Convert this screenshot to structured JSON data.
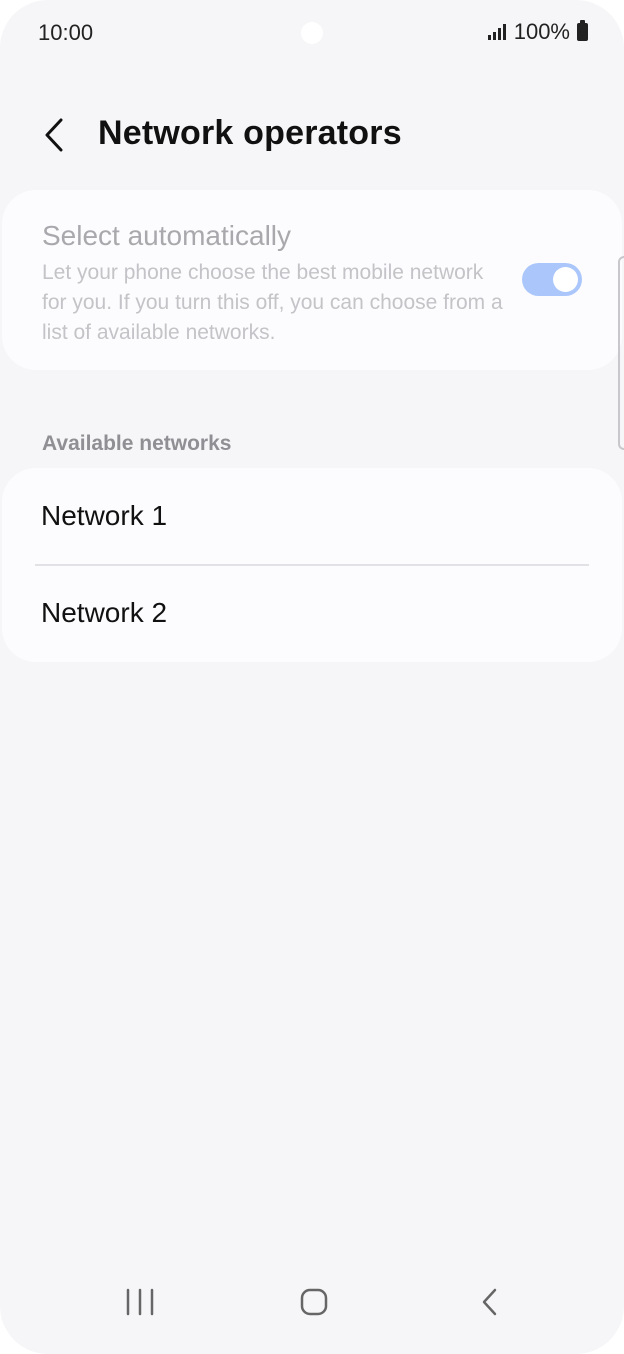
{
  "status_bar": {
    "time": "10:00",
    "battery": "100%",
    "icons": [
      "signal-icon",
      "battery-icon"
    ]
  },
  "header": {
    "back_icon": "chevron-left-icon",
    "title": "Network operators"
  },
  "auto_select": {
    "title": "Select automatically",
    "description": "Let your phone choose the best mobile network for you. If you turn this off, you can choose from a list of available networks.",
    "toggle_on": true,
    "toggle_color": "#aac6fb"
  },
  "available": {
    "label": "Available networks",
    "items": [
      {
        "label": "Network 1"
      },
      {
        "label": "Network 2"
      }
    ]
  },
  "nav_bar": {
    "icons": [
      "recent-apps-icon",
      "home-icon",
      "back-icon"
    ]
  }
}
